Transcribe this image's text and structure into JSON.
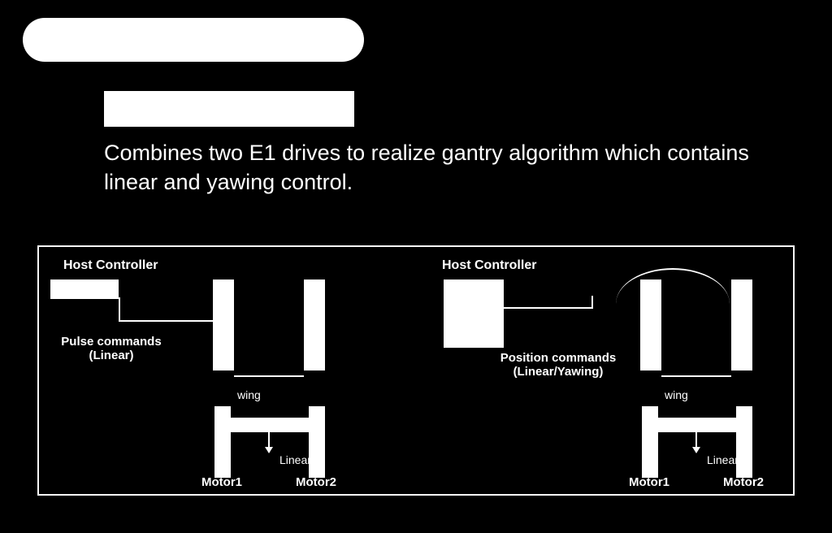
{
  "description": "Combines two E1 drives to realize gantry algorithm which contains linear and yawing control.",
  "left": {
    "host_label": "Host Controller",
    "command_label_line1": "Pulse commands",
    "command_label_line2": "(Linear)",
    "yawing": "wing",
    "linear": "Linear",
    "motor1": "Motor1",
    "motor2": "Motor2"
  },
  "right": {
    "host_label": "Host Controller",
    "command_label_line1": "Position commands",
    "command_label_line2": "(Linear/Yawing)",
    "yawing": "wing",
    "linear": "Linear",
    "motor1": "Motor1",
    "motor2": "Motor2"
  }
}
